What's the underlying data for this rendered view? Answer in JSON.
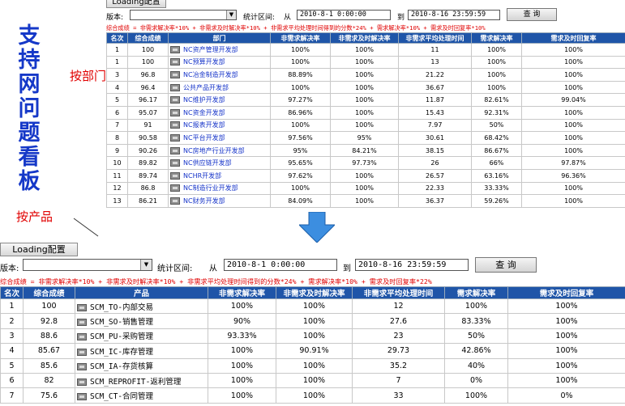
{
  "side_title": "支持网问题看板",
  "annotation_dept": "按部门",
  "annotation_product": "按产品",
  "top_panel": {
    "loading_button": "Loading配置",
    "version_label": "版本:",
    "stat_range_label": "统计区间:",
    "from_label": "从",
    "from_value": "2010-8-1 0:00:00",
    "to_label": "到",
    "to_value": "2010-8-16 23:59:59",
    "query_button": "查 询",
    "formula": "综合成绩 = 非需求解决率*10% + 非需求及时解决率*10% + 非需求平均处理时间得到的分数*24% + 需求解决率*10% + 需求及时回复率*10%",
    "columns": [
      "名次",
      "综合成绩",
      "部门",
      "非需求解决率",
      "非需求及时解决率",
      "非需求平均处理时间",
      "需求解决率",
      "需求及时回复率"
    ],
    "rows": [
      [
        "1",
        "100",
        "NC资产管理开发部",
        "100%",
        "100%",
        "11",
        "100%",
        "100%"
      ],
      [
        "1",
        "100",
        "NC预算开发部",
        "100%",
        "100%",
        "13",
        "100%",
        "100%"
      ],
      [
        "3",
        "96.8",
        "NC冶金制造开发部",
        "88.89%",
        "100%",
        "21.22",
        "100%",
        "100%"
      ],
      [
        "4",
        "96.4",
        "公共产品开发部",
        "100%",
        "100%",
        "36.67",
        "100%",
        "100%"
      ],
      [
        "5",
        "96.17",
        "NC维护开发部",
        "97.27%",
        "100%",
        "11.87",
        "82.61%",
        "99.04%"
      ],
      [
        "6",
        "95.07",
        "NC资金开发部",
        "86.96%",
        "100%",
        "15.43",
        "92.31%",
        "100%"
      ],
      [
        "7",
        "91",
        "NC报表开发部",
        "100%",
        "100%",
        "7.97",
        "50%",
        "100%"
      ],
      [
        "8",
        "90.58",
        "NC平台开发部",
        "97.56%",
        "95%",
        "30.61",
        "68.42%",
        "100%"
      ],
      [
        "9",
        "90.26",
        "NC房地产行业开发部",
        "95%",
        "84.21%",
        "38.15",
        "86.67%",
        "100%"
      ],
      [
        "10",
        "89.82",
        "NC供应链开发部",
        "95.65%",
        "97.73%",
        "26",
        "66%",
        "97.87%"
      ],
      [
        "11",
        "89.74",
        "NCHR开发部",
        "97.62%",
        "100%",
        "26.57",
        "63.16%",
        "96.36%"
      ],
      [
        "12",
        "86.8",
        "NC制造行业开发部",
        "100%",
        "100%",
        "22.33",
        "33.33%",
        "100%"
      ],
      [
        "13",
        "86.21",
        "NC财务开发部",
        "84.09%",
        "100%",
        "36.37",
        "59.26%",
        "100%"
      ]
    ]
  },
  "bottom_panel": {
    "loading_button": "Loading配置",
    "version_label": "版本:",
    "stat_range_label": "统计区间:",
    "from_label": "从",
    "from_value": "2010-8-1 0:00:00",
    "to_label": "到",
    "to_value": "2010-8-16 23:59:59",
    "query_button": "查 询",
    "formula": "综合成绩 = 非需求解决率*10% + 非需求及时解决率*10% + 非需求平均处理时间得到的分数*24% + 需求解决率*10% + 需求及时回复率*22%",
    "columns": [
      "名次",
      "综合成绩",
      "产品",
      "非需求解决率",
      "非需求及时解决率",
      "非需求平均处理时间",
      "需求解决率",
      "需求及时回复率"
    ],
    "rows": [
      [
        "1",
        "100",
        "SCM_TO-内部交易",
        "100%",
        "100%",
        "12",
        "100%",
        "100%"
      ],
      [
        "2",
        "92.8",
        "SCM_SO-销售管理",
        "90%",
        "100%",
        "27.6",
        "83.33%",
        "100%"
      ],
      [
        "3",
        "88.6",
        "SCM_PU-采购管理",
        "93.33%",
        "100%",
        "23",
        "50%",
        "100%"
      ],
      [
        "4",
        "85.67",
        "SCM_IC-库存管理",
        "100%",
        "90.91%",
        "29.73",
        "42.86%",
        "100%"
      ],
      [
        "5",
        "85.6",
        "SCM_IA-存货核算",
        "100%",
        "100%",
        "35.2",
        "40%",
        "100%"
      ],
      [
        "6",
        "82",
        "SCM_REPROFIT-返利管理",
        "100%",
        "100%",
        "7",
        "0%",
        "100%"
      ],
      [
        "7",
        "75.6",
        "SCM_CT-合同管理",
        "100%",
        "100%",
        "33",
        "100%",
        "0%"
      ]
    ]
  },
  "colors": {
    "header_bg": "#1f55a8",
    "accent_red": "#e00000",
    "title_blue": "#1538c8",
    "arrow_blue": "#3c8ee0"
  },
  "icons": {
    "row_icon": "report-icon",
    "arrow": "down-arrow-icon",
    "select_arrow": "chevron-down-icon"
  }
}
